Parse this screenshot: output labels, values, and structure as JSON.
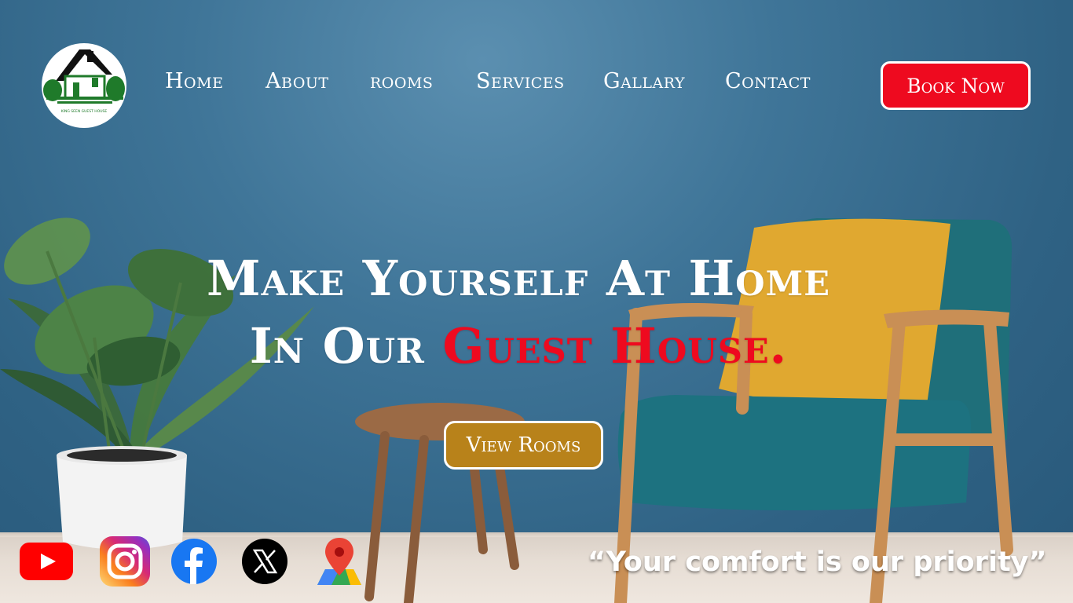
{
  "logo": {
    "name": "logo-emblem",
    "text": "KING SEEN GUEST HOUSE"
  },
  "nav": {
    "items": [
      {
        "label": "Home"
      },
      {
        "label": "About"
      },
      {
        "label": "rooms"
      },
      {
        "label": "Services"
      },
      {
        "label": "Gallary"
      },
      {
        "label": "Contact"
      }
    ],
    "book_label": "Book Now"
  },
  "hero": {
    "line1": "Make Yourself At Home",
    "line2_prefix": "In Our ",
    "line2_accent": "Guest House.",
    "cta_label": "View Rooms"
  },
  "social": [
    {
      "icon": "youtube-icon"
    },
    {
      "icon": "instagram-icon"
    },
    {
      "icon": "facebook-icon"
    },
    {
      "icon": "x-icon"
    },
    {
      "icon": "maps-icon"
    }
  ],
  "tagline": "“Your comfort is our priority”",
  "colors": {
    "accent_red": "#ee0a1f",
    "cta_gold": "#b8821a",
    "wall_blue": "#3f7598"
  }
}
